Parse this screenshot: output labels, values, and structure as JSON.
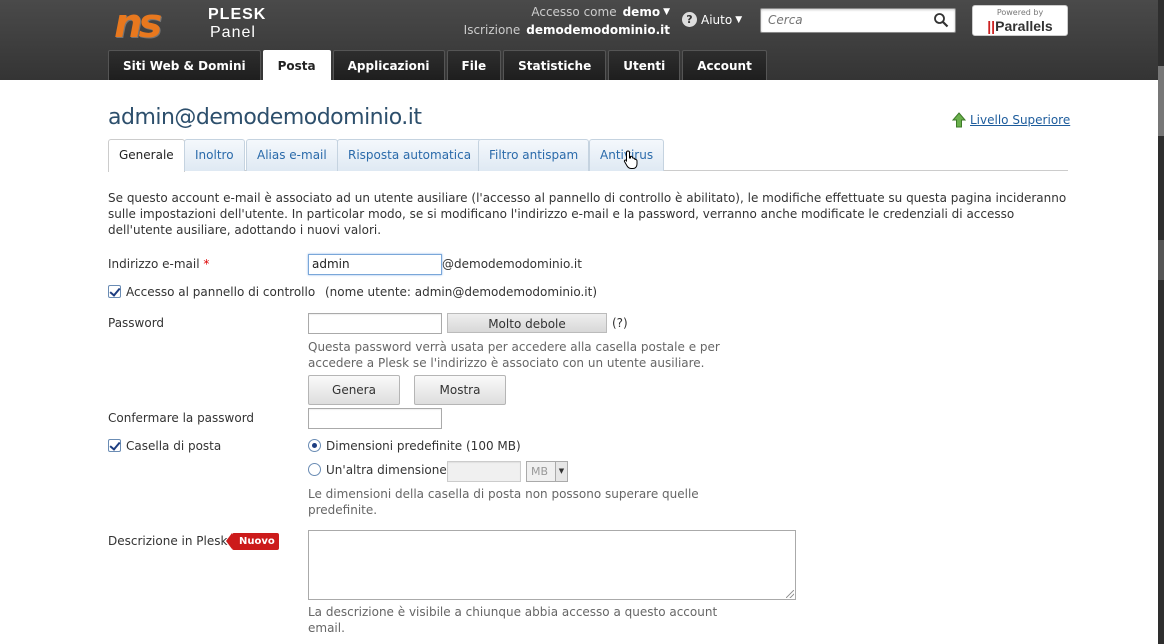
{
  "header": {
    "logo_mark": "ns",
    "logo_word1": "PLESK",
    "logo_word2": "Panel",
    "access_label": "Accesso come",
    "access_user": "demo",
    "subscription_label": "Iscrizione",
    "subscription_value": "demodemodominio.it",
    "help_label": "Aiuto",
    "search_placeholder": "Cerca",
    "powered_by": "Powered by",
    "parallels_brand": "Parallels"
  },
  "main_tabs": [
    "Siti Web & Domini",
    "Posta",
    "Applicazioni",
    "File",
    "Statistiche",
    "Utenti",
    "Account"
  ],
  "active_main_tab": "Posta",
  "page": {
    "title": "admin@demodemodominio.it",
    "up_level": "Livello Superiore"
  },
  "sub_tabs": [
    "Generale",
    "Inoltro",
    "Alias e-mail",
    "Risposta automatica",
    "Filtro antispam",
    "Antivirus"
  ],
  "active_sub_tab": "Generale",
  "intro": "Se questo account e-mail è associato ad un utente ausiliare (l'accesso al pannello di controllo è abilitato), le modifiche effettuate su questa pagina incideranno sulle impostazioni dell'utente. In particolar modo, se si modificano l'indirizzo e-mail e la password, verranno anche modificate le credenziali di accesso dell'utente ausiliare, adottando i nuovi valori.",
  "form": {
    "email_label": "Indirizzo e-mail",
    "email_required_mark": "*",
    "email_value": "admin",
    "email_domain": "@demodemodominio.it",
    "panel_access_label": "Accesso al pannello di controllo",
    "panel_access_note": "(nome utente: admin@demodemodominio.it)",
    "panel_access_checked": true,
    "password_label": "Password",
    "password_strength": "Molto debole",
    "password_help_link": "(?)",
    "password_hint": "Questa password verrà usata per accedere alla casella postale e per accedere a Plesk se l'indirizzo è associato con un utente ausiliare.",
    "generate_button": "Genera",
    "show_button": "Mostra",
    "confirm_password_label": "Confermare la password",
    "mailbox_label": "Casella di posta",
    "mailbox_checked": true,
    "size_default_label": "Dimensioni predefinite (100 MB)",
    "size_other_label": "Un'altra dimensione",
    "size_unit": "MB",
    "size_hint": "Le dimensioni della casella di posta non possono superare quelle predefinite.",
    "description_label": "Descrizione in Plesk",
    "new_badge": "Nuovo",
    "description_hint": "La descrizione è visibile a chiunque abbia accesso a questo account email."
  },
  "colors": {
    "header_bg": "#3c3c3c",
    "title_color": "#2d4f6c",
    "link_color": "#1d5c9c",
    "badge_red": "#cc1b1b"
  }
}
